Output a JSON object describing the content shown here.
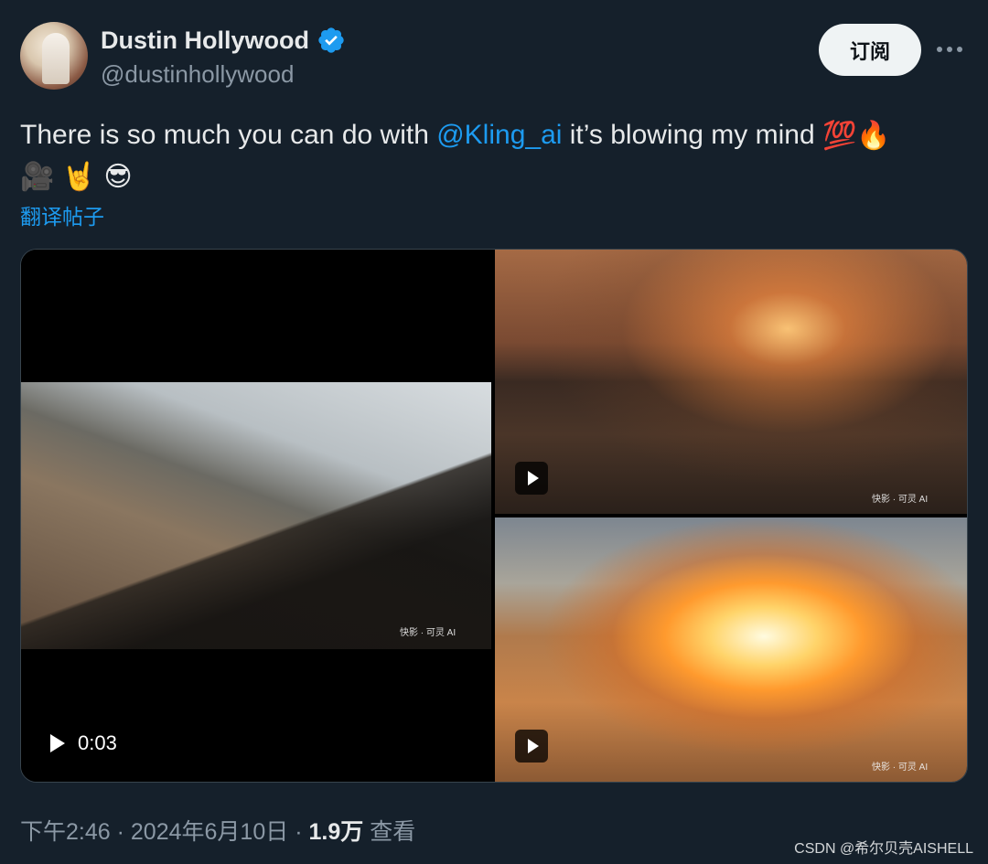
{
  "author": {
    "display_name": "Dustin Hollywood",
    "handle": "@dustinhollywood",
    "verified": true,
    "accent_color": "#1d9bf0"
  },
  "header": {
    "subscribe_label": "订阅",
    "more_icon": "more-horizontal-icon"
  },
  "tweet": {
    "text_before": "There is so much you can do with ",
    "mention": "@Kling_ai",
    "text_after": " it’s blowing my mind ",
    "emojis_line1": [
      "💯",
      "🔥"
    ],
    "emojis_line2": [
      "🎥",
      "🤘",
      "😎"
    ],
    "translate_label": "翻译帖子"
  },
  "media": {
    "video_duration": "0:03",
    "watermark_1": "快影",
    "watermark_2": "可灵 AI"
  },
  "meta": {
    "time": "下午2:46",
    "separator": "·",
    "date": "2024年6月10日",
    "views_count": "1.9万",
    "views_label": "查看"
  },
  "watermark": {
    "text": "CSDN @希尔贝壳AISHELL"
  }
}
